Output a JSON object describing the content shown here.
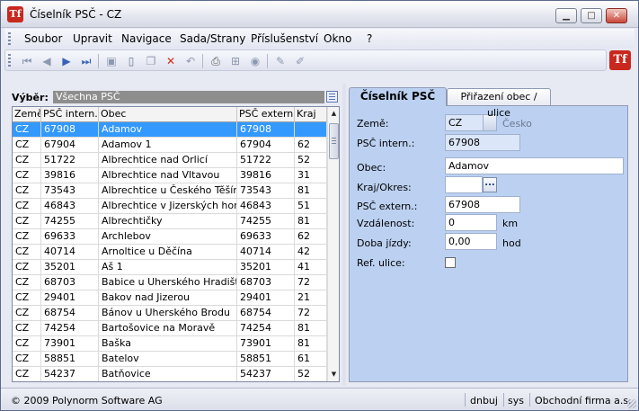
{
  "window": {
    "title": "Číselník PSČ - CZ",
    "controls": {
      "minimize": "▁",
      "maximize": "□",
      "close": "✕"
    },
    "app_icon_text": "Tf"
  },
  "menu": [
    "Soubor",
    "Upravit",
    "Navigace",
    "Sada/Strany",
    "Příslušenství",
    "Okno",
    "?"
  ],
  "toolbar": {
    "icons": [
      "first-icon",
      "prev-icon",
      "next-icon",
      "last-icon",
      "save-icon",
      "new-icon",
      "copy-icon",
      "delete-icon",
      "undo-icon",
      "print-icon",
      "tree-icon",
      "refresh-icon",
      "edit-icon",
      "edit-off-icon"
    ]
  },
  "filter": {
    "label": "Výběr:",
    "value": "Všechna PSČ"
  },
  "grid": {
    "columns": [
      "Země",
      "PSČ intern.",
      "Obec",
      "PSČ extern.",
      "Kraj"
    ],
    "rows": [
      [
        "CZ",
        "67908",
        "Adamov",
        "67908",
        ""
      ],
      [
        "CZ",
        "67904",
        "Adamov 1",
        "67904",
        "62"
      ],
      [
        "CZ",
        "51722",
        "Albrechtice nad Orlicí",
        "51722",
        "52"
      ],
      [
        "CZ",
        "39816",
        "Albrechtice nad Vltavou",
        "39816",
        "31"
      ],
      [
        "CZ",
        "73543",
        "Albrechtice u Českého Těšína",
        "73543",
        "81"
      ],
      [
        "CZ",
        "46843",
        "Albrechtice v Jizerských horác",
        "46843",
        "51"
      ],
      [
        "CZ",
        "74255",
        "Albrechtičky",
        "74255",
        "81"
      ],
      [
        "CZ",
        "69633",
        "Archlebov",
        "69633",
        "62"
      ],
      [
        "CZ",
        "40714",
        "Arnoltice u Děčína",
        "40714",
        "42"
      ],
      [
        "CZ",
        "35201",
        "Aš 1",
        "35201",
        "41"
      ],
      [
        "CZ",
        "68703",
        "Babice u Uherského Hradiště",
        "68703",
        "72"
      ],
      [
        "CZ",
        "29401",
        "Bakov nad Jizerou",
        "29401",
        "21"
      ],
      [
        "CZ",
        "68754",
        "Bánov u Uherského Brodu",
        "68754",
        "72"
      ],
      [
        "CZ",
        "74254",
        "Bartošovice na Moravě",
        "74254",
        "81"
      ],
      [
        "CZ",
        "73901",
        "Baška",
        "73901",
        "81"
      ],
      [
        "CZ",
        "58851",
        "Batelov",
        "58851",
        "61"
      ],
      [
        "CZ",
        "54237",
        "Batňovice",
        "54237",
        "52"
      ]
    ],
    "scroll_up": "▲",
    "scroll_down": "▼"
  },
  "tabs": [
    "Číselník PSČ",
    "Přiřazení obec / ulice"
  ],
  "form": {
    "zeme_label": "Země:",
    "zeme_value": "CZ",
    "zeme_name": "Česko",
    "psc_intern_label": "PSČ intern.:",
    "psc_intern_value": "67908",
    "obec_label": "Obec:",
    "obec_value": "Adamov",
    "kraj_label": "Kraj/Okres:",
    "kraj_value": "",
    "kraj_button": "...",
    "psc_extern_label": "PSČ extern.:",
    "psc_extern_value": "67908",
    "vzdalenost_label": "Vzdálenost:",
    "vzdalenost_value": "0",
    "vzdalenost_unit": "km",
    "doba_label": "Doba jízdy:",
    "doba_value": "0,00",
    "doba_unit": "hod",
    "ref_ulice_label": "Ref. ulice:"
  },
  "status": {
    "copyright": "© 2009 Polynorm Software AG",
    "db": "dnbuj",
    "user": "sys",
    "company": "Obchodní firma a.s."
  }
}
